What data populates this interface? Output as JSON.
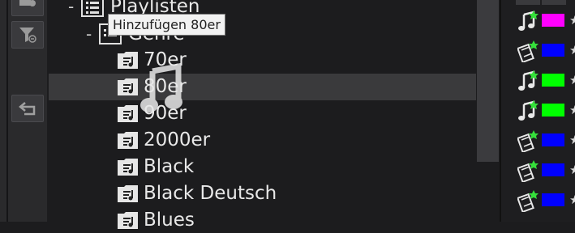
{
  "tooltip": "Hinzufügen 80er",
  "tree": {
    "playlists_label": "Playlisten",
    "genre_label": "Genre",
    "items": [
      "70er",
      "80er",
      "90er",
      "2000er",
      "Black",
      "Black Deutsch",
      "Blues"
    ],
    "selected_index": 1
  },
  "toolbar": {
    "icons": [
      "add-playlist-icon",
      "filter-icon",
      "back-icon"
    ]
  },
  "right_panel": {
    "rows": [
      {
        "type": "music",
        "color": "#ff00ff"
      },
      {
        "type": "video",
        "color": "#0000ff"
      },
      {
        "type": "music",
        "color": "#00ff00"
      },
      {
        "type": "music",
        "color": "#00ff00"
      },
      {
        "type": "video",
        "color": "#0000ff"
      },
      {
        "type": "video",
        "color": "#0000ff"
      },
      {
        "type": "video",
        "color": "#0000ff"
      }
    ],
    "star_glyph": "★"
  }
}
